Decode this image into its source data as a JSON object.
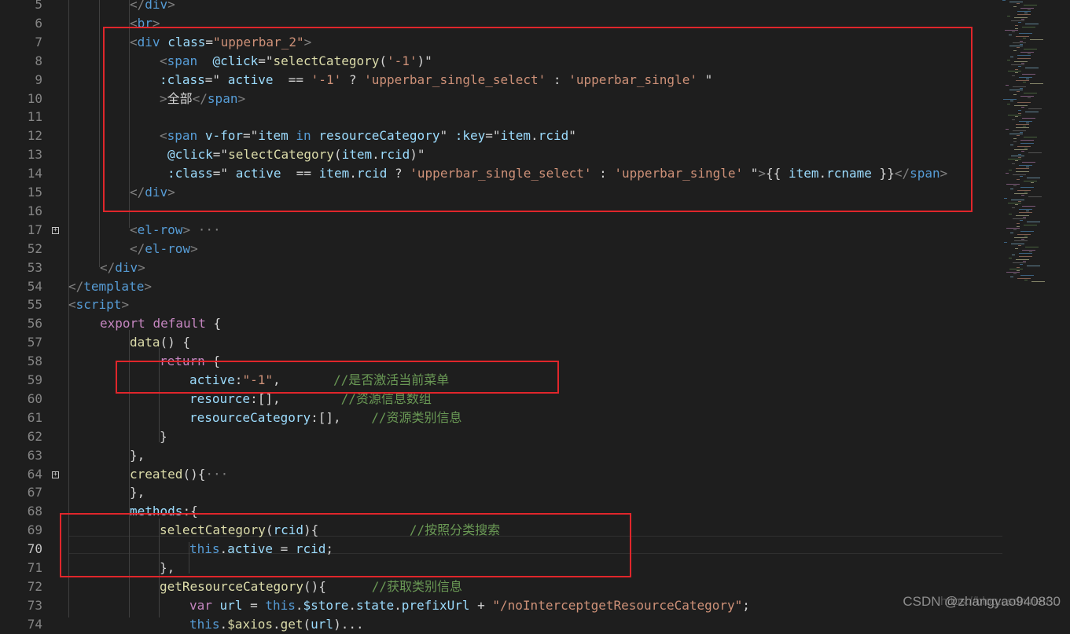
{
  "editor": {
    "lines": [
      {
        "num": "5",
        "tokens": [
          [
            "bracket",
            "</"
          ],
          [
            "tag",
            "div"
          ],
          [
            "bracket",
            ">"
          ]
        ]
      },
      {
        "num": "6",
        "tokens": [
          [
            "bracket",
            "<"
          ],
          [
            "tag",
            "br"
          ],
          [
            "bracket",
            ">"
          ]
        ]
      },
      {
        "num": "7",
        "tokens": [
          [
            "bracket",
            "<"
          ],
          [
            "tag",
            "div"
          ],
          [
            "txt",
            " "
          ],
          [
            "attr",
            "class"
          ],
          [
            "txt",
            "="
          ],
          [
            "str",
            "\"upperbar_2\""
          ],
          [
            "bracket",
            ">"
          ]
        ]
      },
      {
        "num": "8",
        "tokens": [
          [
            "bracket",
            "<"
          ],
          [
            "tag",
            "span"
          ],
          [
            "txt",
            "  "
          ],
          [
            "attr",
            "@click"
          ],
          [
            "txt",
            "=\""
          ],
          [
            "fn",
            "selectCategory"
          ],
          [
            "txt",
            "("
          ],
          [
            "str",
            "'-1'"
          ],
          [
            "txt",
            ")\""
          ]
        ]
      },
      {
        "num": "9",
        "tokens": [
          [
            "attr",
            ":class"
          ],
          [
            "txt",
            "=\" "
          ],
          [
            "var",
            "active"
          ],
          [
            "txt",
            "  == "
          ],
          [
            "str",
            "'-1'"
          ],
          [
            "txt",
            " ? "
          ],
          [
            "str",
            "'upperbar_single_select'"
          ],
          [
            "txt",
            " : "
          ],
          [
            "str",
            "'upperbar_single'"
          ],
          [
            "txt",
            " \""
          ]
        ]
      },
      {
        "num": "10",
        "tokens": [
          [
            "bracket",
            ">"
          ],
          [
            "txt",
            "全部"
          ],
          [
            "bracket",
            "</"
          ],
          [
            "tag",
            "span"
          ],
          [
            "bracket",
            ">"
          ]
        ]
      },
      {
        "num": "11",
        "tokens": []
      },
      {
        "num": "12",
        "tokens": [
          [
            "bracket",
            "<"
          ],
          [
            "tag",
            "span"
          ],
          [
            "txt",
            " "
          ],
          [
            "attr",
            "v-for"
          ],
          [
            "txt",
            "=\""
          ],
          [
            "var",
            "item"
          ],
          [
            "txt",
            " "
          ],
          [
            "tag",
            "in"
          ],
          [
            "txt",
            " "
          ],
          [
            "var",
            "resourceCategory"
          ],
          [
            "txt",
            "\" "
          ],
          [
            "attr",
            ":key"
          ],
          [
            "txt",
            "=\""
          ],
          [
            "var",
            "item"
          ],
          [
            "txt",
            "."
          ],
          [
            "var",
            "rcid"
          ],
          [
            "txt",
            "\""
          ]
        ]
      },
      {
        "num": "13",
        "tokens": [
          [
            "attr",
            "@click"
          ],
          [
            "txt",
            "=\""
          ],
          [
            "fn",
            "selectCategory"
          ],
          [
            "txt",
            "("
          ],
          [
            "var",
            "item"
          ],
          [
            "txt",
            "."
          ],
          [
            "var",
            "rcid"
          ],
          [
            "txt",
            ")\""
          ]
        ]
      },
      {
        "num": "14",
        "tokens": [
          [
            "attr",
            ":class"
          ],
          [
            "txt",
            "=\" "
          ],
          [
            "var",
            "active"
          ],
          [
            "txt",
            "  == "
          ],
          [
            "var",
            "item"
          ],
          [
            "txt",
            "."
          ],
          [
            "var",
            "rcid"
          ],
          [
            "txt",
            " ? "
          ],
          [
            "str",
            "'upperbar_single_select'"
          ],
          [
            "txt",
            " : "
          ],
          [
            "str",
            "'upperbar_single'"
          ],
          [
            "txt",
            " \""
          ],
          [
            "bracket",
            ">"
          ],
          [
            "txt",
            "{{ "
          ],
          [
            "var",
            "item"
          ],
          [
            "txt",
            "."
          ],
          [
            "var",
            "rcname"
          ],
          [
            "txt",
            " }}"
          ],
          [
            "bracket",
            "</"
          ],
          [
            "tag",
            "span"
          ],
          [
            "bracket",
            ">"
          ]
        ]
      },
      {
        "num": "15",
        "tokens": [
          [
            "bracket",
            "</"
          ],
          [
            "tag",
            "div"
          ],
          [
            "bracket",
            ">"
          ]
        ]
      },
      {
        "num": "16",
        "tokens": []
      },
      {
        "num": "17",
        "tokens": [
          [
            "bracket",
            "<"
          ],
          [
            "tag",
            "el-row"
          ],
          [
            "bracket",
            ">"
          ],
          [
            "dots",
            " ···"
          ]
        ],
        "folded": true
      },
      {
        "num": "52",
        "tokens": [
          [
            "bracket",
            "</"
          ],
          [
            "tag",
            "el-row"
          ],
          [
            "bracket",
            ">"
          ]
        ]
      },
      {
        "num": "53",
        "tokens": [
          [
            "bracket",
            "</"
          ],
          [
            "tag",
            "div"
          ],
          [
            "bracket",
            ">"
          ]
        ]
      },
      {
        "num": "54",
        "tokens": [
          [
            "bracket",
            "</"
          ],
          [
            "tag",
            "template"
          ],
          [
            "bracket",
            ">"
          ]
        ]
      },
      {
        "num": "55",
        "tokens": [
          [
            "bracket",
            "<"
          ],
          [
            "tag",
            "script"
          ],
          [
            "bracket",
            ">"
          ]
        ]
      },
      {
        "num": "56",
        "tokens": [
          [
            "kw",
            "export"
          ],
          [
            "txt",
            " "
          ],
          [
            "kw",
            "default"
          ],
          [
            "txt",
            " {"
          ]
        ]
      },
      {
        "num": "57",
        "tokens": [
          [
            "fn",
            "data"
          ],
          [
            "txt",
            "() {"
          ]
        ]
      },
      {
        "num": "58",
        "tokens": [
          [
            "kw",
            "return"
          ],
          [
            "txt",
            " {"
          ]
        ]
      },
      {
        "num": "59",
        "tokens": [
          [
            "var",
            "active"
          ],
          [
            "txt",
            ":"
          ],
          [
            "str",
            "\"-1\""
          ],
          [
            "txt",
            ",       "
          ],
          [
            "cmt",
            "//是否激活当前菜单"
          ]
        ]
      },
      {
        "num": "60",
        "tokens": [
          [
            "var",
            "resource"
          ],
          [
            "txt",
            ":[],        "
          ],
          [
            "cmt",
            "//资源信息数组"
          ]
        ]
      },
      {
        "num": "61",
        "tokens": [
          [
            "var",
            "resourceCategory"
          ],
          [
            "txt",
            ":[],    "
          ],
          [
            "cmt",
            "//资源类别信息"
          ]
        ]
      },
      {
        "num": "62",
        "tokens": [
          [
            "txt",
            "}"
          ]
        ]
      },
      {
        "num": "63",
        "tokens": [
          [
            "txt",
            "},"
          ]
        ]
      },
      {
        "num": "64",
        "tokens": [
          [
            "fn",
            "created"
          ],
          [
            "txt",
            "(){"
          ],
          [
            "dots",
            "···"
          ]
        ],
        "folded": true
      },
      {
        "num": "67",
        "tokens": [
          [
            "txt",
            "},"
          ]
        ]
      },
      {
        "num": "68",
        "tokens": [
          [
            "var",
            "methods"
          ],
          [
            "txt",
            ":{"
          ]
        ]
      },
      {
        "num": "69",
        "tokens": [
          [
            "fn",
            "selectCategory"
          ],
          [
            "txt",
            "("
          ],
          [
            "var",
            "rcid"
          ],
          [
            "txt",
            "){            "
          ],
          [
            "cmt",
            "//按照分类搜索"
          ]
        ]
      },
      {
        "num": "70",
        "tokens": [
          [
            "this",
            "this"
          ],
          [
            "txt",
            "."
          ],
          [
            "var",
            "active"
          ],
          [
            "txt",
            " = "
          ],
          [
            "var",
            "rcid"
          ],
          [
            "txt",
            ";"
          ]
        ],
        "active": true
      },
      {
        "num": "71",
        "tokens": [
          [
            "txt",
            "},"
          ]
        ]
      },
      {
        "num": "72",
        "tokens": [
          [
            "fn",
            "getResourceCategory"
          ],
          [
            "txt",
            "(){      "
          ],
          [
            "cmt",
            "//获取类别信息"
          ]
        ]
      },
      {
        "num": "73",
        "tokens": [
          [
            "kw",
            "var"
          ],
          [
            "txt",
            " "
          ],
          [
            "var",
            "url"
          ],
          [
            "txt",
            " = "
          ],
          [
            "this",
            "this"
          ],
          [
            "txt",
            "."
          ],
          [
            "var",
            "$store"
          ],
          [
            "txt",
            "."
          ],
          [
            "var",
            "state"
          ],
          [
            "txt",
            "."
          ],
          [
            "var",
            "prefixUrl"
          ],
          [
            "txt",
            " + "
          ],
          [
            "str",
            "\"/noInterceptgetResourceCategory\""
          ],
          [
            "txt",
            ";"
          ]
        ]
      },
      {
        "num": "74",
        "tokens": [
          [
            "this",
            "this"
          ],
          [
            "txt",
            "."
          ],
          [
            "fn",
            "$axios"
          ],
          [
            "txt",
            "."
          ],
          [
            "fn",
            "get"
          ],
          [
            "txt",
            "("
          ],
          [
            "var",
            "url"
          ],
          [
            "txt",
            ")..."
          ]
        ]
      }
    ]
  },
  "watermark": {
    "text": "CSDN @zhangyao940830",
    "url": "https://blog.csdn.net/..."
  },
  "colors": {
    "background": "#1e1e1e",
    "highlight_box": "#e0262b"
  }
}
